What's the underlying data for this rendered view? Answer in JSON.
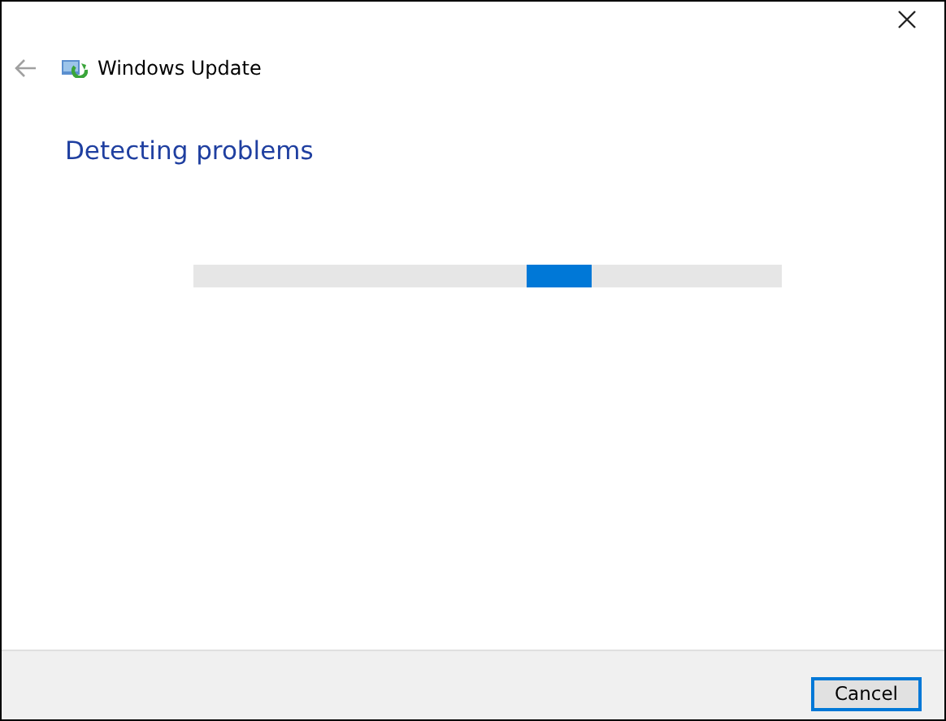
{
  "header": {
    "title": "Windows Update"
  },
  "heading": "Detecting problems",
  "progress": {
    "indeterminate": true
  },
  "buttons": [
    {
      "label": "Cancel",
      "focused": true
    }
  ]
}
